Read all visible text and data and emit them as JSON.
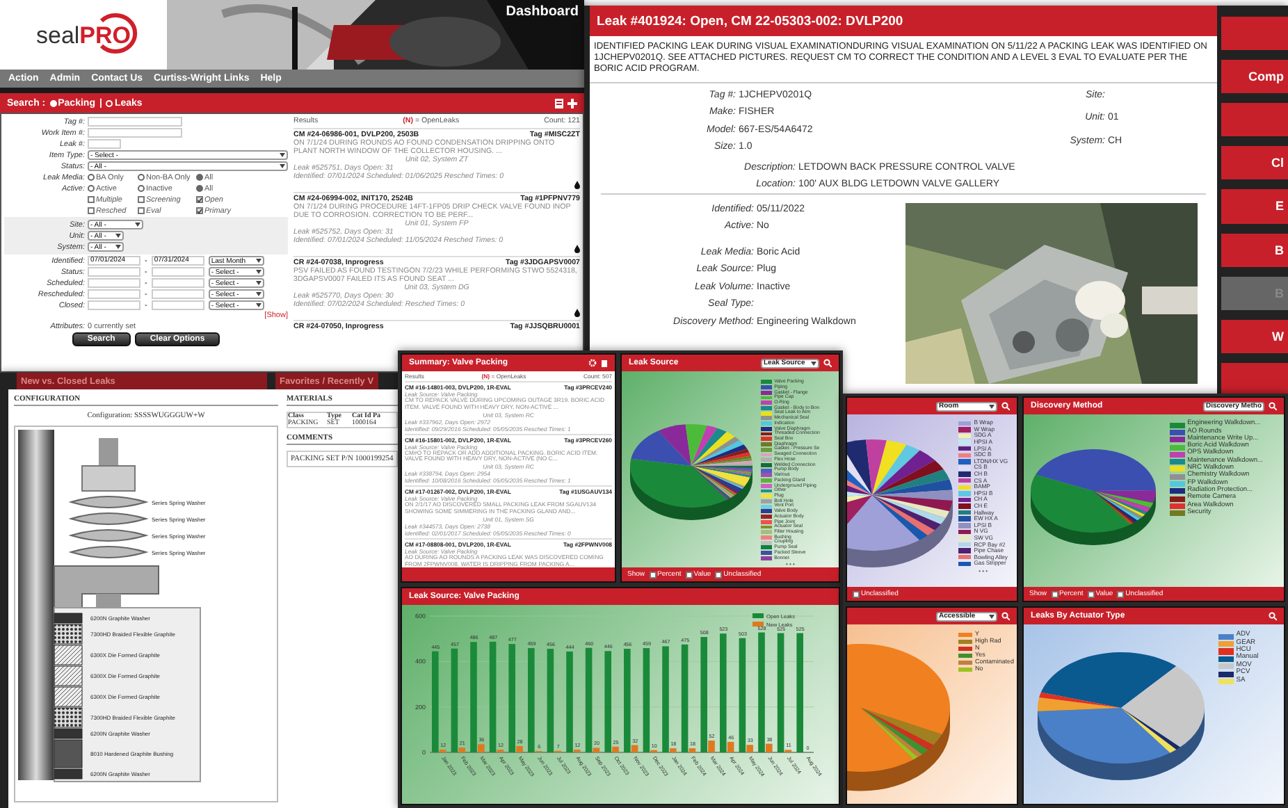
{
  "search_app": {
    "logo": {
      "first": "seal",
      "second": "PRO"
    },
    "title": "Dashboard",
    "menu": [
      "Action",
      "Admin",
      "Contact Us",
      "Curtiss-Wright Links",
      "Help"
    ],
    "search_bar": {
      "label": "Search :",
      "separator": "|",
      "modes": [
        {
          "label": "Packing",
          "selected": true
        },
        {
          "label": "Leaks",
          "selected": false
        }
      ]
    },
    "form": {
      "fields": [
        {
          "label": "Tag #:",
          "kind": "text"
        },
        {
          "label": "Work Item #:",
          "kind": "text"
        },
        {
          "label": "Leak #:",
          "kind": "short"
        },
        {
          "label": "Item Type:",
          "kind": "select",
          "value": "- Select -"
        },
        {
          "label": "Status:",
          "kind": "select",
          "value": "- All -"
        }
      ],
      "radio_groups": [
        {
          "label": "Leak Media:",
          "options": [
            {
              "label": "BA Only",
              "selected": false
            },
            {
              "label": "Non-BA Only",
              "selected": false
            },
            {
              "label": "All",
              "selected": true
            }
          ]
        },
        {
          "label": "Active:",
          "options": [
            {
              "label": "Active",
              "selected": false
            },
            {
              "label": "Inactive",
              "selected": false
            },
            {
              "label": "All",
              "selected": true
            }
          ]
        }
      ],
      "checkboxes": [
        {
          "label": "Multiple",
          "checked": false
        },
        {
          "label": "Screening",
          "checked": false
        },
        {
          "label": "Open",
          "checked": true
        },
        {
          "label": "Resched",
          "checked": false
        },
        {
          "label": "Eval",
          "checked": false
        },
        {
          "label": "Primary",
          "checked": true
        }
      ],
      "location": [
        {
          "label": "Site:",
          "value": "- All -"
        },
        {
          "label": "Unit:",
          "value": "- All -"
        },
        {
          "label": "System:",
          "value": "- All -"
        }
      ],
      "dates": [
        {
          "label": "Identified:",
          "from": "07/01/2024",
          "separator": "-",
          "to": "07/31/2024",
          "range": "Last Month"
        },
        {
          "label": "Status:",
          "separator": "-",
          "range": "- Select -"
        },
        {
          "label": "Scheduled:",
          "separator": "-",
          "range": "- Select -"
        },
        {
          "label": "Rescheduled:",
          "separator": "-",
          "range": "- Select -"
        },
        {
          "label": "Closed:",
          "separator": "-",
          "range": "- Select -"
        }
      ],
      "show_link": "[Show]",
      "attributes": {
        "label": "Attributes:",
        "value": "0 currently set"
      },
      "buttons": [
        "Search",
        "Clear Options"
      ]
    },
    "results": {
      "label": "Results",
      "mark": "(N)",
      "legend": "= OpenLeaks",
      "count": "Count: 121",
      "items": [
        {
          "title": "CM #24-06986-001, DVLP200, 2503B",
          "tag": "Tag #MISC2ZT",
          "text": "ON 7/1/24 DURING ROUNDS AO FOUND CONDENSATION DRIPPING ONTO PLANT NORTH WINDOW OF THE COLLECTOR HOUSING. ...",
          "location": "Unit 02, System ZT",
          "leak": "Leak #525751, Days Open: 31",
          "dates": "Identified: 07/01/2024   Scheduled: 01/06/2025 Resched Times: 0"
        },
        {
          "title": "CM #24-06994-002, INIT170, 2524B",
          "tag": "Tag #1PFPNV779",
          "text": "ON 7/1/24 DURING PROCEDURE 14FT-1FP05 DRIP CHECK VALVE FOUND INOP DUE TO CORROSION. CORRECTION TO BE PERF...",
          "location": "Unit 01, System FP",
          "leak": "Leak #525752, Days Open: 31",
          "dates": "Identified: 07/01/2024   Scheduled: 11/05/2024 Resched Times: 0"
        },
        {
          "title": "CR #24-07038, Inprogress",
          "tag": "Tag #3JDGAPSV0007",
          "text": "PSV FAILED AS FOUND TESTINGON 7/2/23 WHILE PERFORMING STWO 5524318, 3DGAPSV0007 FAILED ITS AS FOUND SEAT ...",
          "location": "Unit 03, System DG",
          "leak": "Leak #525770, Days Open: 30",
          "dates": "Identified: 07/02/2024   Scheduled:   Resched Times: 0"
        },
        {
          "title": "CR #24-07050, Inprogress",
          "tag": "Tag #JJSQBRU0001"
        }
      ]
    }
  },
  "leak_detail": {
    "title": "Leak #401924: Open, CM 22-05303-002: DVLP200",
    "description": "IDENTIFIED PACKING LEAK DURING VISUAL EXAMINATIONDURING VISUAL EXAMINATION ON 5/11/22 A PACKING LEAK WAS IDENTIFIED ON 1JCHEPV0201Q. SEE ATTACHED PICTURES. REQUEST CM TO CORRECT THE CONDITION AND A LEVEL 3 EVAL TO EVALUATE PER THE BORIC ACID PROGRAM.",
    "fields_left": [
      {
        "label": "Tag #:",
        "value": "1JCHEPV0201Q"
      },
      {
        "label": "Make:",
        "value": "FISHER"
      },
      {
        "label": "Model:",
        "value": "667-ES/54A6472"
      },
      {
        "label": "Size:",
        "value": "1.0"
      }
    ],
    "fields_right": [
      {
        "label": "Site:"
      },
      {
        "label": "Unit:",
        "value": "01"
      },
      {
        "label": "System:",
        "value": "CH"
      }
    ],
    "fields_wide": [
      {
        "label": "Description:",
        "value": "LETDOWN BACK PRESSURE CONTROL VALVE"
      },
      {
        "label": "Location:",
        "value": "100' AUX BLDG LETDOWN VALVE GALLERY"
      }
    ],
    "fields_status": [
      {
        "label": "Identified:",
        "value": "05/11/2022"
      },
      {
        "label": "Active:",
        "value": "No"
      }
    ],
    "fields_leak": [
      {
        "label": "Leak Media:",
        "value": "Boric Acid"
      },
      {
        "label": "Leak Source:",
        "value": "Plug"
      },
      {
        "label": "Leak Volume:",
        "value": "Inactive"
      },
      {
        "label": "Seal Type:"
      },
      {
        "label": "Discovery Method:",
        "value": "Engineering Walkdown"
      }
    ],
    "side_buttons": [
      {
        "label": "Comp",
        "disabled": false
      },
      {
        "label": "Cl",
        "disabled": false
      },
      {
        "label": "E",
        "disabled": false
      },
      {
        "label": "B",
        "disabled": false
      },
      {
        "label": "B",
        "disabled": true
      },
      {
        "label": "W",
        "disabled": false
      }
    ]
  },
  "configuration": {
    "behind_bars": [
      "New vs. Closed Leaks",
      "Favorites / Recently V"
    ],
    "title": "CONFIGURATION",
    "configuration_line": "Configuration: SSSSWUGGGUW+W",
    "spring_labels": [
      "Series Spring Washer",
      "Series Spring Washer",
      "Series Spring Washer",
      "Series Spring Washer"
    ],
    "stack": [
      {
        "label": "6200N Graphite Washer",
        "kind": "washer"
      },
      {
        "label": "7300HD Braided Flexible Graphite",
        "kind": "braid"
      },
      {
        "label": "6300X Die Formed Graphite",
        "kind": "formed"
      },
      {
        "label": "6300X Die Formed Graphite",
        "kind": "formed"
      },
      {
        "label": "6300X Die Formed Graphite",
        "kind": "formed"
      },
      {
        "label": "7300HD Braided Flexible Graphite",
        "kind": "braid"
      },
      {
        "label": "6200N Graphite Washer",
        "kind": "washer"
      },
      {
        "label": "8010 Hardened Graphite Bushing",
        "kind": "bushing"
      },
      {
        "label": "6200N Graphite Washer",
        "kind": "washer"
      }
    ],
    "materials": {
      "title": "MATERIALS",
      "columns": [
        "Class",
        "Type",
        "Cat Id Pa"
      ],
      "rows": [
        [
          "PACKING",
          "SET",
          "1000164"
        ]
      ]
    },
    "comments": {
      "title": "COMMENTS",
      "text": "PACKING SET P/N 1000199254"
    }
  },
  "dashboard": {
    "summary": {
      "title": "Summary: Valve Packing",
      "label": "Results",
      "mark": "(N)",
      "legend": "= OpenLeaks",
      "count": "Count: 507",
      "items": [
        {
          "title": "CM #16-14801-003, DVLP200, 1R-EVAL",
          "tag": "Tag #3PRCEV240",
          "source": "Leak Source: Valve Packing",
          "text": "CM TO REPACK VALVE DURING UPCOMING OUTAGE 3R19. BORIC ACID ITEM. VALVE FOUND WITH HEAVY DRY, NON-ACTIVE ...",
          "location": "Unit 03, System RC",
          "leak": "Leak #337962, Days Open: 2972",
          "dates": "Identified: 09/29/2016   Scheduled: 05/05/2035 Resched Times: 1"
        },
        {
          "title": "CM #16-15801-002, DVLP200, 1R-EVAL",
          "tag": "Tag #3PRCEV260",
          "source": "Leak Source: Valve Packing",
          "text": "CM#O TO REPACK OR ADD ADDITIONAL PACKING. BORIC ACID ITEM. VALVE FOUND WITH HEAVY DRY, NON-ACTIVE (NO C...",
          "location": "Unit 03, System RC",
          "leak": "Leak #338794, Days Open: 2954",
          "dates": "Identified: 10/08/2016   Scheduled: 05/05/2035 Resched Times: 1"
        },
        {
          "title": "CM #17-01267-002, DVLP200, 1R-EVAL",
          "tag": "Tag #1USGAUV134",
          "source": "Leak Source: Valve Packing",
          "text": "ON 2/1/17 AO DISCOVERED SMALL PACKING LEAK FROM SGAUV134 SHOWING SOME SIMMERING IN THE PACKING GLAND AND...",
          "location": "Unit 01, System SG",
          "leak": "Leak #344573, Days Open: 2738",
          "dates": "Identified: 02/01/2017   Scheduled: 05/05/2035 Resched Times: 0"
        },
        {
          "title": "CM #17-08808-001, DVLP200, 1R-EVAL",
          "tag": "Tag #2FPWNV008",
          "source": "Leak Source: Valve Packing",
          "text": "AO DURING AO ROUNDS A PACKING LEAK WAS DISCOVERED COMING FROM 2FPWNV008. WATER IS DRIPPING FROM PACKING A..."
        }
      ]
    },
    "pies": [
      {
        "kind": "green",
        "title": "Leak Source",
        "dropdown": "Leak Source",
        "more": "• • •",
        "footer": {
          "label": "Show",
          "options": [
            {
              "label": "Percent",
              "checked": false
            },
            {
              "label": "Value",
              "checked": false
            },
            {
              "label": "Unclassified",
              "checked": false
            }
          ]
        },
        "legend": [
          {
            "label": "Valve Packing",
            "color": "#1a8a3a"
          },
          {
            "label": "Piping",
            "color": "#3a4fb0"
          },
          {
            "label": "Gasket - Flange",
            "color": "#8a2a9a"
          },
          {
            "label": "Pipe Cap",
            "color": "#4dbb3a"
          },
          {
            "label": "O-Ring",
            "color": "#c040b0"
          },
          {
            "label": "Gasket - Body to Bon",
            "color": "#1a8a8a"
          },
          {
            "label": "Seat Leak to Atm",
            "color": "#e8e020"
          },
          {
            "label": "Mechanical Seal",
            "color": "#909090"
          },
          {
            "label": "Indication",
            "color": "#50c8e0"
          },
          {
            "label": "Valve Diaphragm",
            "color": "#202a80"
          },
          {
            "label": "Threaded Connection",
            "color": "#8a1a1a"
          },
          {
            "label": "Seal Box",
            "color": "#e03030"
          },
          {
            "label": "Diaphragm",
            "color": "#707a20"
          },
          {
            "label": "Gasket - Pressure Se",
            "color": "#6a9a40"
          },
          {
            "label": "Swaged Connection",
            "color": "#e0a0c0"
          },
          {
            "label": "Flex Hose",
            "color": "#b0b0b0"
          },
          {
            "label": "Welded Connection",
            "color": "#1a6a3a"
          },
          {
            "label": "Pump Body",
            "color": "#5060c0"
          },
          {
            "label": "Various",
            "color": "#a050b0"
          },
          {
            "label": "Packing Gland",
            "color": "#60b040"
          },
          {
            "label": "Underground Piping",
            "color": "#d060c0"
          },
          {
            "label": "Other",
            "color": "#209090"
          },
          {
            "label": "Plug",
            "color": "#f0e040"
          },
          {
            "label": "Bolt Hole",
            "color": "#a0a0a0"
          },
          {
            "label": "Vent Port",
            "color": "#70d0e0"
          },
          {
            "label": "Valve Body",
            "color": "#303a90"
          },
          {
            "label": "Actuator Body",
            "color": "#a02020"
          },
          {
            "label": "Pipe Joint",
            "color": "#f05050"
          },
          {
            "label": "Actuator Seal",
            "color": "#80902a"
          },
          {
            "label": "Filter Housing",
            "color": "#a0c080"
          },
          {
            "label": "Bushing",
            "color": "#f08080"
          },
          {
            "label": "Coupling",
            "color": "#c0c0c0"
          },
          {
            "label": "Pump Seal",
            "color": "#108040"
          },
          {
            "label": "Packed Sleeve",
            "color": "#4050a0"
          },
          {
            "label": "Bonnet",
            "color": "#9040a0"
          }
        ]
      },
      {
        "kind": "lilac",
        "dropdown": "Room",
        "more": "• • •",
        "footer": {
          "options": [
            {
              "label": "Unclassified",
              "checked": false
            }
          ]
        },
        "legend": [
          {
            "label": "B Wrap",
            "color": "#a0a0d8"
          },
          {
            "label": "W Wrap",
            "color": "#a02060"
          },
          {
            "label": "SDG A",
            "color": "#f0f0b0"
          },
          {
            "label": "HPSI A",
            "color": "#c0e8f0"
          },
          {
            "label": "LPSI A",
            "color": "#602080"
          },
          {
            "label": "SDC B",
            "color": "#f08080"
          },
          {
            "label": "LTDN/HX VG",
            "color": "#2060c0"
          },
          {
            "label": "CS B",
            "color": "#e0e0f0"
          },
          {
            "label": "CH B",
            "color": "#202a70"
          },
          {
            "label": "CS A",
            "color": "#c040a0"
          },
          {
            "label": "BAMP",
            "color": "#f0e020"
          },
          {
            "label": "HPSI B",
            "color": "#60c8e0"
          },
          {
            "label": "CH A",
            "color": "#702090"
          },
          {
            "label": "CH E",
            "color": "#801020"
          },
          {
            "label": "Hallway",
            "color": "#208080"
          },
          {
            "label": "EW HX A",
            "color": "#2050a0"
          },
          {
            "label": "LPSI B",
            "color": "#9090c0"
          },
          {
            "label": "N VG",
            "color": "#901850"
          },
          {
            "label": "SW VG",
            "color": "#e8e8c0"
          },
          {
            "label": "RCP Bay #2",
            "color": "#b0d8e8"
          },
          {
            "label": "Pipe Chase",
            "color": "#502070"
          },
          {
            "label": "Bowling Alley",
            "color": "#e87070"
          },
          {
            "label": "Gas Stripper",
            "color": "#1858b0"
          }
        ]
      },
      {
        "kind": "green",
        "title": "Discovery Method",
        "dropdown": "Discovery Metho",
        "footer": {
          "label": "Show",
          "options": [
            {
              "label": "Percent",
              "checked": false
            },
            {
              "label": "Value",
              "checked": false
            },
            {
              "label": "Unclassified",
              "checked": false
            }
          ]
        },
        "legend": [
          {
            "label": "Engineering Walkdown...",
            "color": "#1a8a3a"
          },
          {
            "label": "AO Rounds",
            "color": "#3a4fb0"
          },
          {
            "label": "Maintenance Write Up...",
            "color": "#8a2a9a"
          },
          {
            "label": "Boric Acid Walkdown",
            "color": "#4dbb3a"
          },
          {
            "label": "OPS Walkdown",
            "color": "#c040b0"
          },
          {
            "label": "Maintenance Walkdown...",
            "color": "#1a8a8a"
          },
          {
            "label": "NRC Walkdown",
            "color": "#e8e020"
          },
          {
            "label": "Chemistry Walkdown",
            "color": "#909090"
          },
          {
            "label": "FP Walkdown",
            "color": "#50c8e0"
          },
          {
            "label": "Radiation Protection...",
            "color": "#202a80"
          },
          {
            "label": "Remote Camera",
            "color": "#8a1a1a"
          },
          {
            "label": "Area Walkdown",
            "color": "#e03030"
          },
          {
            "label": "Security",
            "color": "#707a20"
          }
        ]
      },
      {
        "kind": "orange",
        "dropdown": "Accessible",
        "legend": [
          {
            "label": "Y",
            "color": "#f08020"
          },
          {
            "label": "High Rad",
            "color": "#a08020"
          },
          {
            "label": "N",
            "color": "#d03020"
          },
          {
            "label": "Yes",
            "color": "#409030"
          },
          {
            "label": "Contaminated",
            "color": "#c08040"
          },
          {
            "label": "No",
            "color": "#a0c020"
          }
        ]
      },
      {
        "kind": "blue",
        "title": "Leaks By Actuator Type",
        "legend": [
          {
            "label": "ADV",
            "color": "#4a80c8"
          },
          {
            "label": "GEAR",
            "color": "#f0a030"
          },
          {
            "label": "HCU",
            "color": "#e03020"
          },
          {
            "label": "Manual",
            "color": "#0a5a90"
          },
          {
            "label": "MOV",
            "color": "#c8c8c8"
          },
          {
            "label": "PCV",
            "color": "#1a2a6a"
          },
          {
            "label": "SA",
            "color": "#f0e060"
          }
        ]
      }
    ],
    "bar_panel": {
      "title": "Leak Source: Valve Packing",
      "chart_data": {
        "type": "bar",
        "categories": [
          "Jan 2023",
          "Feb 2023",
          "Mar 2023",
          "Apr 2023",
          "May 2023",
          "Jun 2023",
          "Jul 2023",
          "Aug 2023",
          "Sep 2023",
          "Oct 2023",
          "Nov 2023",
          "Dec 2023",
          "Jan 2024",
          "Feb 2024",
          "Mar 2024",
          "Apr 2024",
          "May 2024",
          "Jun 2024",
          "Jul 2024",
          "Aug 2024"
        ],
        "series": [
          {
            "name": "Open Leaks",
            "color": "#1a8a3a",
            "values": [
              445,
              457,
              486,
              487,
              477,
              459,
              456,
              444,
              460,
              446,
              456,
              459,
              467,
              475,
              508,
              523,
              503,
              528,
              525,
              525
            ]
          },
          {
            "name": "New Leaks",
            "color": "#e07820",
            "values": [
              12,
              21,
              36,
              12,
              28,
              6,
              7,
              12,
              20,
              25,
              32,
              10,
              18,
              18,
              52,
              46,
              33,
              38,
              11,
              0
            ]
          }
        ],
        "ylim": [
          0,
          600
        ],
        "yticks": [
          0,
          200,
          400,
          600
        ],
        "data_labels": true,
        "legend": "upper right"
      }
    }
  }
}
